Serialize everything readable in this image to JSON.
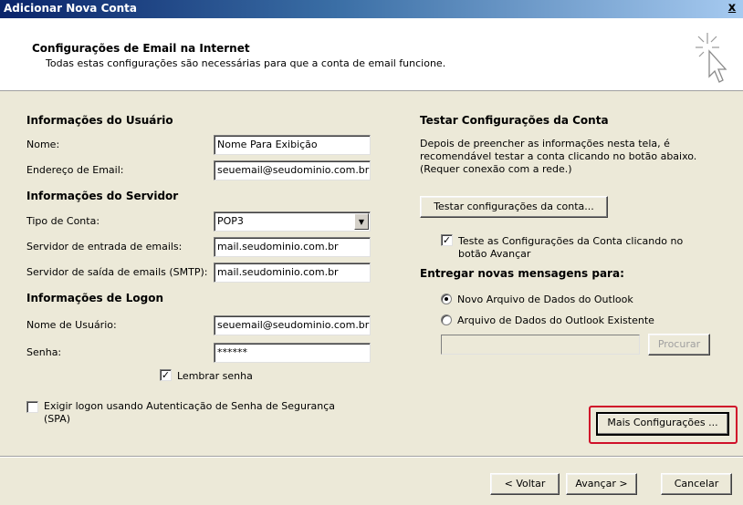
{
  "window": {
    "title": "Adicionar Nova Conta",
    "close_label": "x"
  },
  "header": {
    "title": "Configurações de Email na Internet",
    "subtitle": "Todas estas configurações são necessárias para que a conta de email funcione."
  },
  "user_info": {
    "section_title": "Informações do Usuário",
    "name_label": "Nome:",
    "name_value": "Nome Para Exibição",
    "email_label": "Endereço de Email:",
    "email_value": "seuemail@seudominio.com.br"
  },
  "server_info": {
    "section_title": "Informações do Servidor",
    "account_type_label": "Tipo de Conta:",
    "account_type_value": "POP3",
    "incoming_label": "Servidor de entrada de emails:",
    "incoming_value": "mail.seudominio.com.br",
    "outgoing_label": "Servidor de saída de emails (SMTP):",
    "outgoing_value": "mail.seudominio.com.br"
  },
  "logon_info": {
    "section_title": "Informações de Logon",
    "username_label": "Nome de Usuário:",
    "username_value": "seuemail@seudominio.com.br",
    "password_label": "Senha:",
    "password_value": "******",
    "remember_label": "Lembrar senha",
    "remember_checked": true,
    "spa_label_line1": "Exigir logon usando Autenticação de Senha de Segurança",
    "spa_label_line2": "(SPA)",
    "spa_checked": false
  },
  "test_settings": {
    "section_title": "Testar Configurações da Conta",
    "description_line1": "Depois de preencher as informações nesta tela, é",
    "description_line2": "recomendável testar a conta clicando no botão abaixo.",
    "description_line3": "(Requer conexão com a rede.)",
    "test_button": "Testar configurações da conta...",
    "auto_test_label_line1": "Teste as Configurações da Conta clicando no",
    "auto_test_label_line2": "botão Avançar",
    "auto_test_checked": true
  },
  "deliver": {
    "section_title": "Entregar novas mensagens para:",
    "option_new": "Novo Arquivo de Dados do Outlook",
    "option_existing": "Arquivo de Dados do Outlook Existente",
    "selected": "new",
    "path_value": "",
    "browse_button": "Procurar"
  },
  "more_settings_button": "Mais Configurações ...",
  "footer": {
    "back": "< Voltar",
    "next": "Avançar >",
    "cancel": "Cancelar"
  },
  "colors": {
    "highlight": "#d0102a",
    "title_bar": "#0a246a"
  }
}
